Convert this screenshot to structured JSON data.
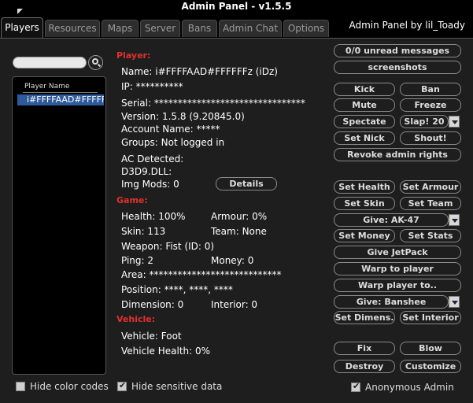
{
  "window": {
    "title": "Admin Panel  -  v1.5.5",
    "byline": "Admin Panel by lil_Toady"
  },
  "tabs": [
    "Players",
    "Resources",
    "Maps",
    "Server",
    "Bans",
    "Admin Chat",
    "Options"
  ],
  "player_list": {
    "header": "Player Name",
    "rows": [
      "i#FFFFAAD#FFFFFFz"
    ],
    "search_placeholder": ""
  },
  "options": {
    "hide_color_codes": "Hide color codes",
    "hide_color_codes_checked": false,
    "hide_sensitive_data": "Hide sensitive data",
    "hide_sensitive_data_checked": true,
    "anonymous_admin": "Anonymous Admin",
    "anonymous_admin_checked": true
  },
  "player": {
    "section": "Player:",
    "name": "Name: i#FFFFAAD#FFFFFFz (iDz)",
    "ip": "IP: **********",
    "serial": "Serial: ********************************",
    "version": "Version: 1.5.8  (9.20845.0)",
    "account_name": "Account Name: *****",
    "groups": "Groups: Not logged in",
    "ac_detected": "AC Detected:",
    "d3d9": "D3D9.DLL:",
    "img_mods": "Img Mods: 0",
    "details_button": "Details"
  },
  "game": {
    "section": "Game:",
    "health": "Health: 100%",
    "armour": "Armour: 0%",
    "skin": "Skin: 113",
    "team": "Team: None",
    "weapon": "Weapon: Fist (ID: 0)",
    "ping": "Ping: 2",
    "money": "Money: 0",
    "area": "Area: ****************************",
    "position": "Position: ****, ****, ****",
    "dimension": "Dimension: 0",
    "interior": "Interior: 0"
  },
  "vehicle": {
    "section": "Vehicle:",
    "vehicle": "Vehicle: Foot",
    "vehicle_health": "Vehicle Health: 0%"
  },
  "actions": {
    "unread_messages": "0/0 unread messages",
    "screenshots": "screenshots",
    "kick": "Kick",
    "ban": "Ban",
    "mute": "Mute",
    "freeze": "Freeze",
    "spectate": "Spectate",
    "slap": "Slap! 20",
    "set_nick": "Set Nick",
    "shout": "Shout!",
    "revoke_admin": "Revoke admin rights",
    "set_health": "Set Health",
    "set_armour": "Set Armour",
    "set_skin": "Set Skin",
    "set_team": "Set Team",
    "give_weapon": "Give: AK-47",
    "set_money": "Set Money",
    "set_stats": "Set Stats",
    "give_jetpack": "Give JetPack",
    "warp_to_player": "Warp to player",
    "warp_player_to": "Warp player to..",
    "give_vehicle": "Give: Banshee",
    "set_dimension": "Set Dimens.",
    "set_interior": "Set Interior",
    "fix": "Fix",
    "blow": "Blow",
    "destroy": "Destroy",
    "customize": "Customize"
  }
}
